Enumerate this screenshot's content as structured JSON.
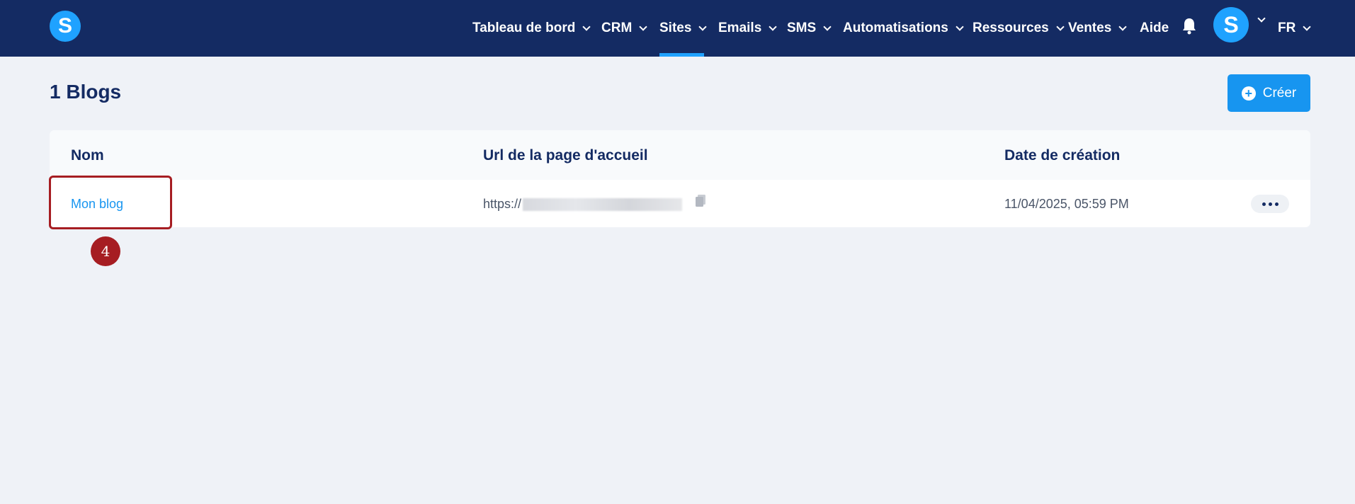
{
  "app": {
    "logo_letter": "S",
    "avatar_letter": "S",
    "brand_color": "#142b63",
    "accent_color": "#1795f0"
  },
  "nav": {
    "items": [
      {
        "label": "Tableau de bord",
        "has_dropdown": true
      },
      {
        "label": "CRM",
        "has_dropdown": true
      },
      {
        "label": "Sites",
        "has_dropdown": true,
        "active": true
      },
      {
        "label": "Emails",
        "has_dropdown": true
      },
      {
        "label": "SMS",
        "has_dropdown": true
      },
      {
        "label": "Automatisations",
        "has_dropdown": true
      },
      {
        "label": "Ressources",
        "has_dropdown": true
      },
      {
        "label": "Ventes",
        "has_dropdown": true
      },
      {
        "label": "Aide",
        "has_dropdown": false
      }
    ],
    "language": "FR"
  },
  "page": {
    "title": "1 Blogs",
    "create_button_label": "Créer"
  },
  "table": {
    "columns": [
      "Nom",
      "Url de la page d'accueil",
      "Date de création"
    ],
    "rows": [
      {
        "name": "Mon blog",
        "url_prefix": "https://",
        "created": "11/04/2025, 05:59 PM"
      }
    ]
  },
  "annotation": {
    "step_number": "4",
    "color": "#a61d22"
  }
}
